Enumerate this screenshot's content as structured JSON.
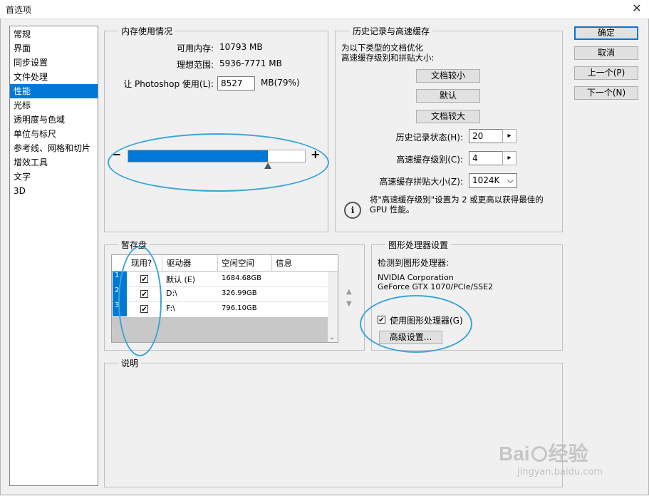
{
  "window": {
    "title": "首选项",
    "close_glyph": "✕"
  },
  "sidebar": {
    "items": [
      {
        "label": "常规"
      },
      {
        "label": "界面"
      },
      {
        "label": "同步设置"
      },
      {
        "label": "文件处理"
      },
      {
        "label": "性能",
        "selected": true
      },
      {
        "label": "光标"
      },
      {
        "label": "透明度与色域"
      },
      {
        "label": "单位与标尺"
      },
      {
        "label": "参考线、网格和切片"
      },
      {
        "label": "增效工具"
      },
      {
        "label": "文字"
      },
      {
        "label": "3D"
      }
    ]
  },
  "memory": {
    "group_label": "内存使用情况",
    "available_label": "可用内存:",
    "available_value": "10793 MB",
    "ideal_label": "理想范围:",
    "ideal_value": "5936-7771 MB",
    "use_label": "让 Photoshop 使用(L):",
    "use_value": "8527",
    "use_unit": "MB(79%)",
    "minus": "−",
    "plus": "+",
    "slider_fraction": 0.79
  },
  "history": {
    "group_label": "历史记录与高速缓存",
    "optimize_text_1": "为以下类型的文档优化",
    "optimize_text_2": "高速缓存级别和拼贴大小:",
    "btn_small": "文档较小",
    "btn_default": "默认",
    "btn_large": "文档较大",
    "states_label": "历史记录状态(H):",
    "states_value": "20",
    "cache_levels_label": "高速缓存级别(C):",
    "cache_levels_value": "4",
    "tile_size_label": "高速缓存拼贴大小(Z):",
    "tile_size_value": "1024K",
    "info_line_1": "将\"高速缓存级别\"设置为 2 或更高以获得最佳的",
    "info_line_2": "GPU 性能。",
    "spin_glyph": "▸",
    "dropdown_glyph": "⌵",
    "info_glyph": "i"
  },
  "scratch": {
    "group_label": "暂存盘",
    "headers": [
      "现用?",
      "驱动器",
      "空闲空间",
      "信息"
    ],
    "rows": [
      {
        "num": "1",
        "active": true,
        "drive": "默认 (E)",
        "free": "1684.68GB",
        "info": ""
      },
      {
        "num": "2",
        "active": true,
        "drive": "D:\\",
        "free": "326.99GB",
        "info": ""
      },
      {
        "num": "3",
        "active": true,
        "drive": "F:\\",
        "free": "796.10GB",
        "info": ""
      }
    ],
    "check_glyph": "✔",
    "up_glyph": "▲",
    "down_glyph": "▼",
    "scroll_down_glyph": "⌄"
  },
  "gpu": {
    "group_label": "图形处理器设置",
    "detected_label": "检测到图形处理器:",
    "vendor": "NVIDIA Corporation",
    "model": "GeForce GTX 1070/PCIe/SSE2",
    "use_gpu_label": "使用图形处理器(G)",
    "use_gpu_checked": true,
    "advanced_button": "高级设置..."
  },
  "description": {
    "group_label": "说明"
  },
  "actions": {
    "ok": "确定",
    "cancel": "取消",
    "prev": "上一个(P)",
    "next": "下一个(N)"
  },
  "watermark": {
    "brand": "Bai",
    "brand_suffix": "经验",
    "url": "jingyan.baidu.com"
  },
  "colors": {
    "accent": "#0078d7",
    "ring": "#3aa5d6"
  }
}
